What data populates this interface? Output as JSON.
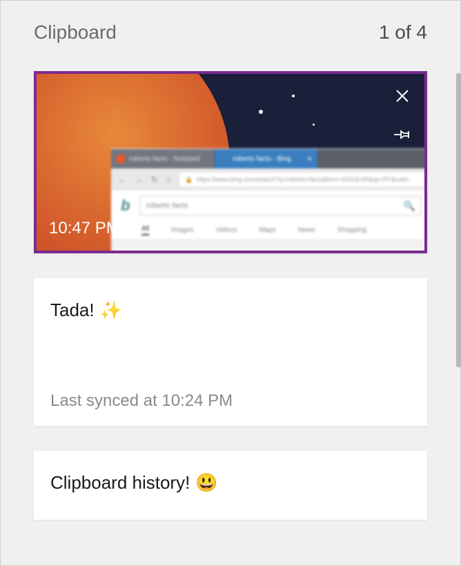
{
  "header": {
    "title": "Clipboard",
    "counter": "1 of 4"
  },
  "items": [
    {
      "type": "image",
      "selected": true,
      "timestamp": "10:47 PM",
      "icons": {
        "close": "close-icon",
        "pin": "pin-icon"
      }
    },
    {
      "type": "text",
      "content": "Tada!",
      "emoji": "✨",
      "meta": "Last synced at 10:24 PM"
    },
    {
      "type": "text",
      "content": "Clipboard history!",
      "emoji": "😃"
    }
  ],
  "colors": {
    "selection_border": "#7b2a8f",
    "panel_bg": "#f0f0f0",
    "card_bg": "#ffffff"
  }
}
